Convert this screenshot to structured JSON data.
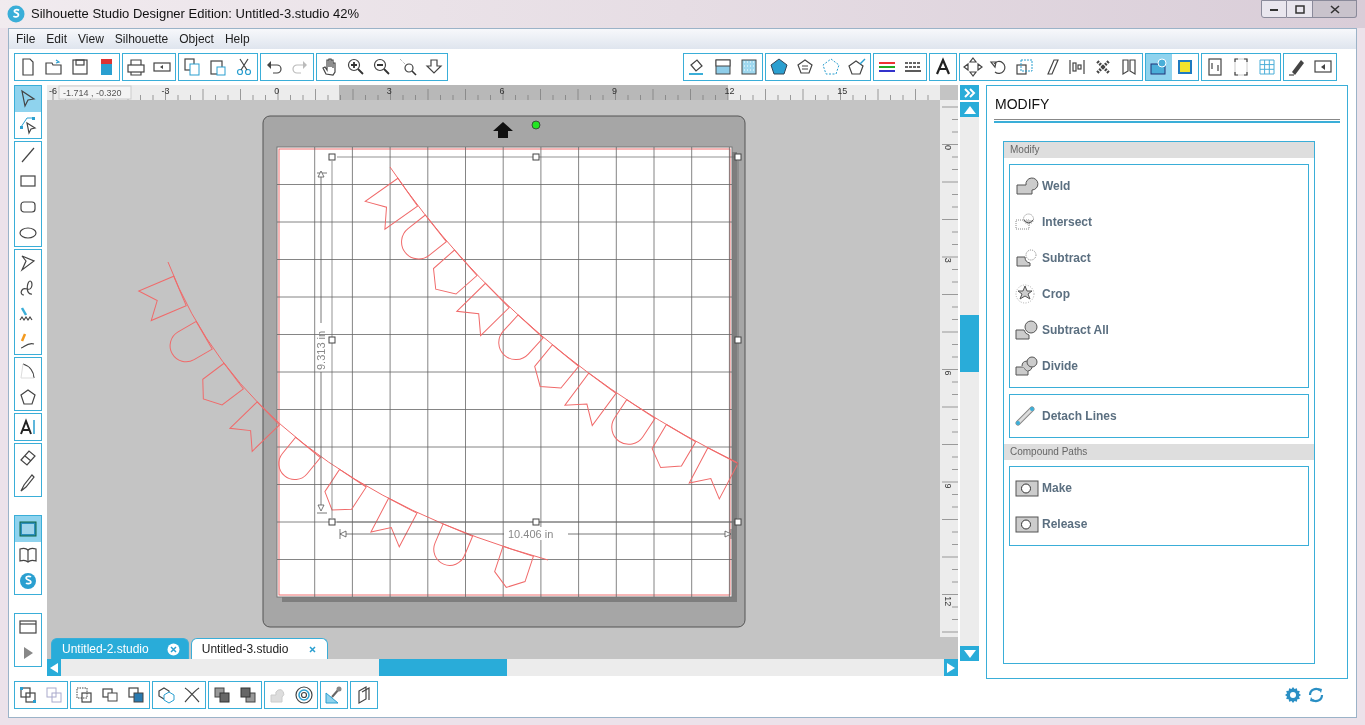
{
  "window": {
    "title": "Silhouette Studio Designer Edition: Untitled-3.studio 42%"
  },
  "menu": [
    "File",
    "Edit",
    "View",
    "Silhouette",
    "Object",
    "Help"
  ],
  "top_toolbar": [
    {
      "tools": [
        {
          "selected": false
        },
        {
          "selected": false
        },
        {
          "selected": false
        },
        {
          "selected": false
        }
      ]
    },
    {
      "tools": [
        {
          "selected": false
        },
        {
          "selected": false
        }
      ]
    },
    {
      "tools": [
        {
          "selected": false
        },
        {
          "selected": false
        },
        {
          "selected": false
        }
      ]
    },
    {
      "tools": [
        {
          "selected": false
        },
        {
          "selected": false
        }
      ]
    },
    {
      "tools": [
        {
          "selected": false
        },
        {
          "selected": false
        },
        {
          "selected": false
        },
        {
          "selected": false
        },
        {
          "selected": false
        }
      ]
    }
  ],
  "right_toolbar": [
    {
      "tools": [
        {
          "selected": false
        },
        {
          "selected": false
        },
        {
          "selected": false
        }
      ]
    },
    {
      "tools": [
        {
          "selected": false
        },
        {
          "selected": false
        },
        {
          "selected": false
        },
        {
          "selected": false
        }
      ]
    },
    {
      "tools": [
        {
          "selected": false
        },
        {
          "selected": false
        }
      ]
    },
    {
      "tools": [
        {
          "selected": false
        }
      ]
    },
    {
      "tools": [
        {
          "selected": false
        },
        {
          "selected": false
        },
        {
          "selected": false
        },
        {
          "selected": false
        },
        {
          "selected": false
        },
        {
          "selected": false
        },
        {
          "selected": false
        }
      ]
    },
    {
      "tools": [
        {
          "selected": true
        },
        {
          "selected": false
        }
      ]
    },
    {
      "tools": [
        {
          "selected": false
        },
        {
          "selected": false
        },
        {
          "selected": false
        }
      ]
    },
    {
      "tools": [
        {
          "selected": false
        },
        {
          "selected": false
        }
      ]
    }
  ],
  "left_toolbar": [
    {
      "tools": [
        {
          "selected": true
        },
        {
          "selected": false
        }
      ]
    },
    {
      "tools": [
        {
          "selected": false
        },
        {
          "selected": false
        },
        {
          "selected": false
        },
        {
          "selected": false
        }
      ]
    },
    {
      "tools": [
        {
          "selected": false
        },
        {
          "selected": false
        },
        {
          "selected": false
        },
        {
          "selected": false
        }
      ]
    },
    {
      "tools": [
        {
          "selected": false
        },
        {
          "selected": false
        }
      ]
    },
    {
      "tools": [
        {
          "selected": false
        }
      ]
    },
    {
      "tools": [
        {
          "selected": false
        },
        {
          "selected": false
        }
      ]
    },
    {
      "tools": [
        {
          "selected": true
        },
        {
          "selected": false
        },
        {
          "selected": false
        }
      ]
    },
    {
      "tools": [
        {
          "selected": false
        },
        {
          "selected": false
        }
      ]
    }
  ],
  "bottom_toolbar": [
    {
      "tools": [
        {
          "selected": false
        },
        {
          "selected": false
        }
      ]
    },
    {
      "tools": [
        {
          "selected": false
        },
        {
          "selected": false
        },
        {
          "selected": false
        }
      ]
    },
    {
      "tools": [
        {
          "selected": false
        },
        {
          "selected": false
        }
      ]
    },
    {
      "tools": [
        {
          "selected": false
        },
        {
          "selected": false
        }
      ]
    },
    {
      "tools": [
        {
          "selected": false
        },
        {
          "selected": false
        }
      ]
    },
    {
      "tools": [
        {
          "selected": false
        }
      ]
    },
    {
      "tools": [
        {
          "selected": false
        }
      ]
    }
  ],
  "ruler": {
    "cursor_position": "-1.714 , -0.320",
    "horizontal_labels": [
      "-6",
      "-3",
      "0",
      "3",
      "6",
      "9",
      "12",
      "15"
    ],
    "vertical_labels": [
      "0",
      "3",
      "6",
      "9",
      "12"
    ]
  },
  "canvas": {
    "height_label": "9.313 in",
    "width_label": "10.406 in"
  },
  "tabs": [
    {
      "label": "Untitled-2.studio",
      "selected": false
    },
    {
      "label": "Untitled-3.studio",
      "selected": true
    }
  ],
  "panel": {
    "title": "MODIFY",
    "sections": [
      {
        "heading": "Modify",
        "groups": [
          [
            "Weld",
            "Intersect",
            "Subtract",
            "Crop",
            "Subtract All",
            "Divide"
          ],
          [
            "Detach Lines"
          ]
        ]
      },
      {
        "heading": "Compound Paths",
        "groups": [
          [
            "Make",
            "Release"
          ]
        ]
      }
    ]
  }
}
